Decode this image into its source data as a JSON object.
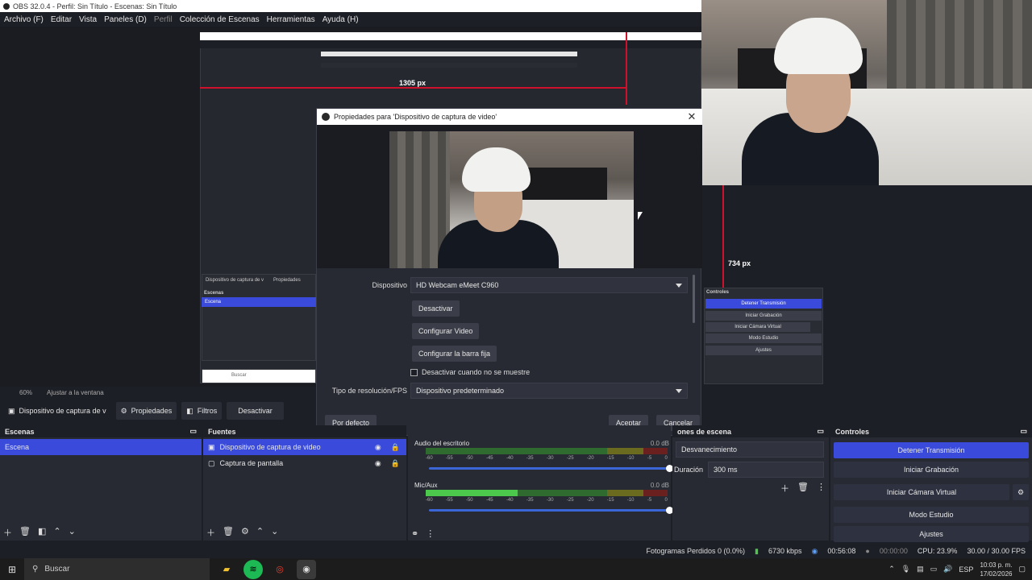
{
  "window": {
    "title": "OBS 32.0.4 - Perfil: Sin Título - Escenas: Sin Título"
  },
  "menu": {
    "items": [
      "Archivo (F)",
      "Editar",
      "Vista",
      "Paneles (D)",
      "Perfil",
      "Colección de Escenas",
      "Herramientas",
      "Ayuda (H)"
    ]
  },
  "preview": {
    "measure_h": "1305 px",
    "measure_v": "734 px"
  },
  "dialog": {
    "title": "Propiedades para 'Dispositivo de captura de video'",
    "device_label": "Dispositivo",
    "device_value": "HD Webcam eMeet C960",
    "btn_deactivate": "Desactivar",
    "btn_config_video": "Configurar Video",
    "btn_config_bar": "Configurar la barra fija",
    "check_hide": "Desactivar cuando no se muestre",
    "res_label": "Tipo de resolución/FPS",
    "res_value": "Dispositivo predeterminado",
    "btn_default": "Por defecto",
    "btn_accept": "Aceptar",
    "btn_cancel": "Cancelar"
  },
  "context": {
    "zoom": "60%",
    "fit": "Ajustar a la ventana"
  },
  "sourcebar": {
    "source": "Dispositivo de captura de v",
    "properties": "Propiedades",
    "filters": "Filtros",
    "deactivate": "Desactivar"
  },
  "scenes": {
    "title": "Escenas",
    "items": [
      "Escena"
    ]
  },
  "sources": {
    "title": "Fuentes",
    "items": [
      "Dispositivo de captura de video",
      "Captura de pantalla"
    ]
  },
  "mixer": {
    "channels": [
      {
        "name": "Audio del escritorio",
        "db": "0.0 dB",
        "level": 0.0
      },
      {
        "name": "Mic/Aux",
        "db": "0.0 dB",
        "level": 0.38
      }
    ],
    "ticks": [
      "-60",
      "-55",
      "-50",
      "-45",
      "-40",
      "-35",
      "-30",
      "-25",
      "-20",
      "-15",
      "-10",
      "-5",
      "0"
    ]
  },
  "transitions": {
    "title": "ones de escena",
    "type": "Desvanecimiento",
    "duration_label": "Duración",
    "duration": "300 ms"
  },
  "controls": {
    "title": "Controles",
    "stop_stream": "Detener Transmisión",
    "start_record": "Iniciar Grabación",
    "virtual_cam": "Iniciar Cámara Virtual",
    "studio": "Modo Estudio",
    "settings": "Ajustes"
  },
  "status": {
    "dropped": "Fotogramas Perdidos 0 (0.0%)",
    "bitrate": "6730 kbps",
    "stream_time": "00:56:08",
    "record_time": "00:00:00",
    "cpu": "CPU: 23.9%",
    "fps": "30.00 / 30.00 FPS"
  },
  "taskbar": {
    "search": "Buscar",
    "lang": "ESP",
    "time": "10:03 p. m.",
    "date": "17/02/2026"
  },
  "mini": {
    "scenes": "Escenas",
    "scene": "Escena",
    "controls": "Controles",
    "search": "Buscar",
    "source": "Dispositivo de captura de v",
    "props": "Propiedades",
    "zoom": "60%",
    "fit": "Ajustar a la ventana"
  },
  "mini_controls": [
    "Detener Transmisión",
    "Iniciar Grabación",
    "Iniciar Cámara Virtual",
    "Modo Estudio",
    "Ajustes"
  ]
}
